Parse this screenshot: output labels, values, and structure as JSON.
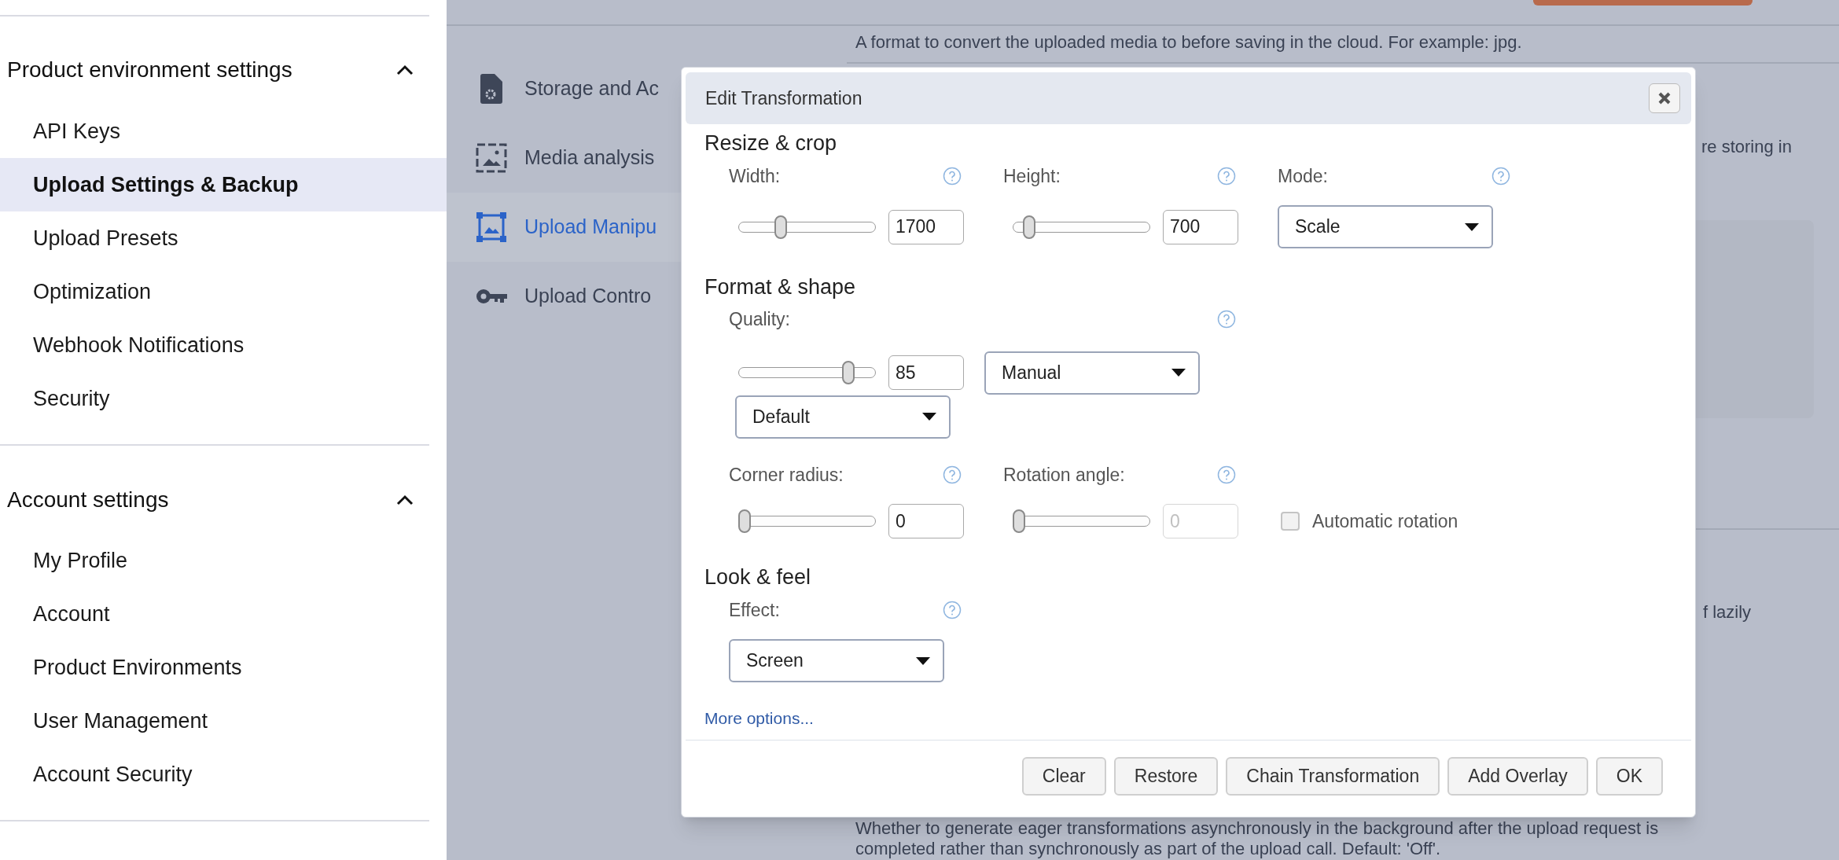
{
  "sidebar": {
    "sections": [
      {
        "title": "Product environment settings",
        "expanded": true,
        "items": [
          {
            "label": "API Keys",
            "selected": false
          },
          {
            "label": "Upload Settings & Backup",
            "selected": true
          },
          {
            "label": "Upload Presets",
            "selected": false
          },
          {
            "label": "Optimization",
            "selected": false
          },
          {
            "label": "Webhook Notifications",
            "selected": false
          },
          {
            "label": "Security",
            "selected": false
          }
        ]
      },
      {
        "title": "Account settings",
        "expanded": true,
        "items": [
          {
            "label": "My Profile",
            "selected": false
          },
          {
            "label": "Account",
            "selected": false
          },
          {
            "label": "Product Environments",
            "selected": false
          },
          {
            "label": "User Management",
            "selected": false
          },
          {
            "label": "Account Security",
            "selected": false
          }
        ]
      }
    ]
  },
  "nav": {
    "items": [
      {
        "label": "Storage and Ac",
        "kind": "file-gear",
        "selected": false
      },
      {
        "label": "Media analysis",
        "kind": "image",
        "selected": false
      },
      {
        "label": "Upload Manipu",
        "kind": "frame",
        "selected": true
      },
      {
        "label": "Upload Contro",
        "kind": "key",
        "selected": false
      }
    ]
  },
  "content": {
    "top_text": "A format to convert the uploaded media to before saving in the cloud. For example: jpg.",
    "fragment_1": "re storing in",
    "fragment_2": "f lazily",
    "bottom_lines": [
      "Whether to generate eager transformations asynchronously in the background after the upload request is",
      "completed rather than synchronously as part of the upload call. Default: 'Off'."
    ]
  },
  "dialog": {
    "title": "Edit Transformation",
    "sections": [
      {
        "title": "Resize & crop",
        "rows": [
          {
            "cells": [
              {
                "kind": "slider",
                "label": "Width:",
                "level": 0.29,
                "value": "1700",
                "disabled": false
              },
              {
                "kind": "slider",
                "label": "Height:",
                "level": 0.08,
                "value": "700",
                "disabled": false
              },
              {
                "kind": "select",
                "label": "Mode:",
                "value": "Scale"
              }
            ]
          }
        ]
      },
      {
        "title": "Format & shape",
        "rows": [
          {
            "label": "Quality:",
            "cells": [
              {
                "kind": "slider",
                "level": 0.83,
                "value": "85",
                "disabled": false
              },
              {
                "kind": "select",
                "value": "Manual"
              }
            ]
          },
          {
            "cells": [
              {
                "kind": "select",
                "value": "Default"
              }
            ]
          },
          {
            "cells": [
              {
                "kind": "slider",
                "label": "Corner radius:",
                "level": 0,
                "value": "0",
                "disabled": false
              },
              {
                "kind": "slider",
                "label": "Rotation angle:",
                "level": 0,
                "value": "0",
                "disabled": true
              },
              {
                "kind": "checkbox",
                "label": "Automatic rotation",
                "checked": false
              }
            ]
          }
        ]
      },
      {
        "title": "Look & feel",
        "rows": [
          {
            "cells": [
              {
                "kind": "select",
                "label": "Effect:",
                "value": "Screen"
              }
            ]
          }
        ]
      }
    ],
    "more_link": "More options...",
    "buttons": [
      "Clear",
      "Restore",
      "Chain Transformation",
      "Add Overlay",
      "OK"
    ]
  }
}
